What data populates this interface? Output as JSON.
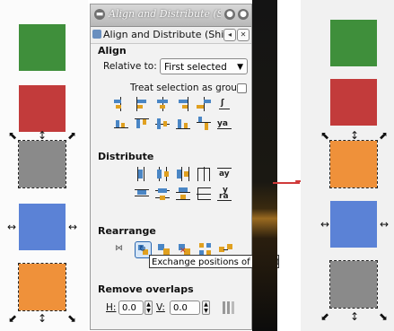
{
  "left_canvas": {
    "squares": [
      {
        "name": "green",
        "color": "#3f8f3b"
      },
      {
        "name": "red",
        "color": "#c23b3b"
      },
      {
        "name": "gray",
        "color": "#8a8a8a"
      },
      {
        "name": "blue",
        "color": "#5b82d6"
      },
      {
        "name": "orange",
        "color": "#ef913a"
      }
    ]
  },
  "right_canvas": {
    "squares": [
      {
        "name": "green",
        "color": "#3f8f3b"
      },
      {
        "name": "red",
        "color": "#c23b3b"
      },
      {
        "name": "orange",
        "color": "#ef913a"
      },
      {
        "name": "blue",
        "color": "#5b82d6"
      },
      {
        "name": "gray",
        "color": "#8a8a8a"
      }
    ]
  },
  "dialog": {
    "window_title": "Align and Distribute (Shi",
    "tab_title": "Align and Distribute (Shi...",
    "align": {
      "title": "Align",
      "relative_label": "Relative to:",
      "relative_value": "First selected",
      "group_label": "Treat selection as group:"
    },
    "distribute": {
      "title": "Distribute"
    },
    "rearrange": {
      "title": "Rearrange",
      "tooltip": "Exchange positions of select"
    },
    "remove_overlaps": {
      "title": "Remove overlaps",
      "h_label": "H:",
      "h_value": "0.0",
      "v_label": "V:",
      "v_value": "0.0"
    }
  },
  "colors": {
    "accent": "#2a67b0",
    "arrow": "#d03a3a"
  }
}
